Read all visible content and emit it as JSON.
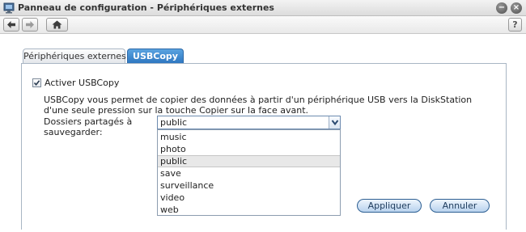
{
  "window": {
    "title": "Panneau de configuration - Périphériques externes",
    "minimize_glyph": "−",
    "close_glyph": "×"
  },
  "toolbar": {
    "back_icon": "arrow-left-icon",
    "forward_icon": "arrow-right-icon",
    "home_icon": "home-icon",
    "help_label": "?"
  },
  "tabs": [
    {
      "label": "Périphériques externes",
      "active": false
    },
    {
      "label": "USBCopy",
      "active": true
    }
  ],
  "form": {
    "enable_checked": true,
    "enable_label": "Activer USBCopy",
    "description": "USBCopy vous permet de copier des données à partir d'un périphérique USB vers la DiskStation d'une seule pression sur la touche Copier sur la face avant.",
    "shared_folder_label": "Dossiers partagés à sauvegarder:",
    "shared_folder_value": "public",
    "shared_folder_options": [
      "music",
      "photo",
      "public",
      "save",
      "surveillance",
      "video",
      "web"
    ],
    "selected_option": "public"
  },
  "buttons": {
    "apply": "Appliquer",
    "cancel": "Annuler"
  },
  "colors": {
    "active_tab": "#2b74bf",
    "border": "#a9b6c4"
  }
}
